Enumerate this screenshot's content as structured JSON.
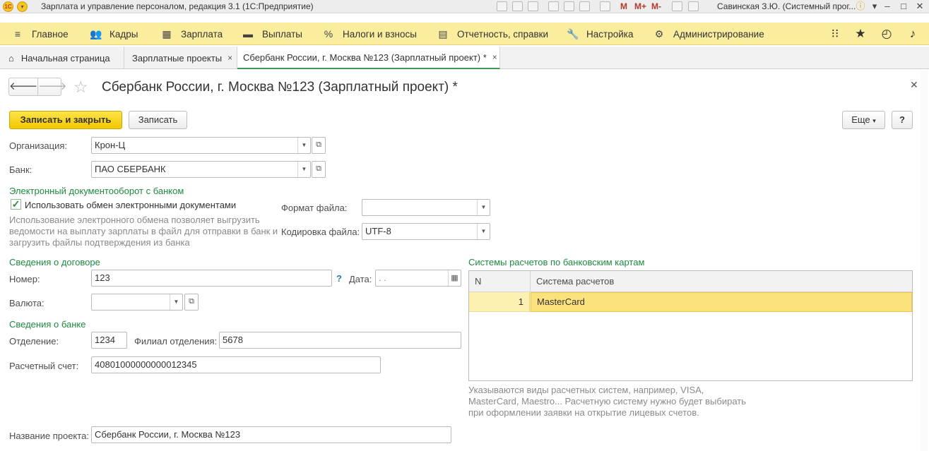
{
  "titlebar": {
    "app_title": "Зарплата и управление персоналом, редакция 3.1  (1С:Предприятие)",
    "logo_text": "1С",
    "m_labels": [
      "M",
      "M+",
      "M-"
    ],
    "user": "Савинская З.Ю. (Системный прог..."
  },
  "sections": [
    {
      "label": "Главное",
      "icon": "menu-icon",
      "glyph": "≡"
    },
    {
      "label": "Кадры",
      "icon": "people-icon",
      "glyph": "👥"
    },
    {
      "label": "Зарплата",
      "icon": "calculator-icon",
      "glyph": "▦"
    },
    {
      "label": "Выплаты",
      "icon": "wallet-icon",
      "glyph": "▬"
    },
    {
      "label": "Налоги и взносы",
      "icon": "percent-icon",
      "glyph": "%"
    },
    {
      "label": "Отчетность, справки",
      "icon": "report-icon",
      "glyph": "▤"
    },
    {
      "label": "Настройка",
      "icon": "wrench-icon",
      "glyph": "🔧"
    },
    {
      "label": "Администрирование",
      "icon": "gear-icon",
      "glyph": "⚙"
    }
  ],
  "tabs": [
    {
      "label": "Начальная страница",
      "icon": "home-icon"
    },
    {
      "label": "Зарплатные проекты",
      "close": "×"
    },
    {
      "label": "Сбербанк России, г. Москва №123 (Зарплатный проект) *",
      "close": "×"
    }
  ],
  "form": {
    "title": "Сбербанк России, г. Москва №123 (Зарплатный проект) *",
    "save_close_label": "Записать и закрыть",
    "save_label": "Записать",
    "more_label": "Еще",
    "help_label": "?",
    "organization_label": "Организация:",
    "organization_value": "Крон-Ц",
    "bank_label": "Банк:",
    "bank_value": "ПАО СБЕРБАНК",
    "edo_group": "Электронный документооборот с банком",
    "edo_checkbox_label": "Использовать обмен электронными документами",
    "edo_checked": true,
    "edo_hint": [
      "Использование электронного обмена позволяет выгрузить",
      "ведомости на выплату зарплаты в файл для отправки в банк и",
      "загрузить файлы подтверждения из банка"
    ],
    "file_format_label": "Формат файла:",
    "file_format_value": "",
    "encoding_label": "Кодировка файла:",
    "encoding_value": "UTF-8",
    "contract_group": "Сведения о договоре",
    "number_label": "Номер:",
    "number_value": "123",
    "number_help": "?",
    "date_label": "Дата:",
    "date_value": " .  .",
    "currency_label": "Валюта:",
    "currency_value": "",
    "bank_info_group": "Сведения о банке",
    "branch_label": "Отделение:",
    "branch_value": "1234",
    "sub_branch_label": "Филиал отделения:",
    "sub_branch_value": "5678",
    "account_label": "Расчетный счет:",
    "account_value": "40801000000000012345",
    "project_name_label": "Название проекта:",
    "project_name_value": "Сбербанк России, г. Москва №123"
  },
  "card_systems": {
    "group": "Системы расчетов по банковским картам",
    "columns": [
      "N",
      "Система расчетов"
    ],
    "rows": [
      {
        "n": "1",
        "system": "MasterCard"
      }
    ],
    "hint": [
      "Указываются виды расчетных систем, например, VISA,",
      "MasterCard, Maestro... Расчетную систему нужно будет выбирать",
      "при оформлении заявки на открытие лицевых счетов."
    ]
  },
  "colors": {
    "section_bar": "#fbed9e",
    "group_title": "#1d8a3f",
    "primary_button": "#f3c700",
    "selected_row": "#fbe27c"
  }
}
